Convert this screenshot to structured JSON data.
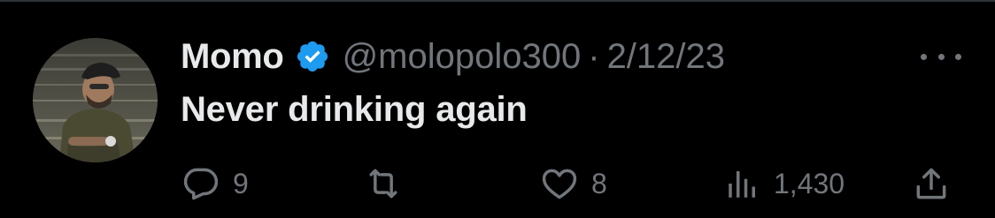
{
  "tweet": {
    "author": {
      "display_name": "Momo",
      "handle": "@molopolo300",
      "verified": true,
      "avatar_icon": "user-avatar-photo"
    },
    "separator": "·",
    "date": "2/12/23",
    "text": "Never drinking again",
    "more_icon": "more-horizontal-icon",
    "actions": {
      "reply": {
        "icon": "reply-icon",
        "count": "9"
      },
      "retweet": {
        "icon": "retweet-icon",
        "count": ""
      },
      "like": {
        "icon": "heart-icon",
        "count": "8"
      },
      "views": {
        "icon": "views-bar-chart-icon",
        "count": "1,430"
      },
      "share": {
        "icon": "share-icon"
      }
    }
  },
  "colors": {
    "background": "#000000",
    "primary_text": "#e7e9ea",
    "secondary_text": "#71767b",
    "verified_badge": "#1d9bf0"
  }
}
